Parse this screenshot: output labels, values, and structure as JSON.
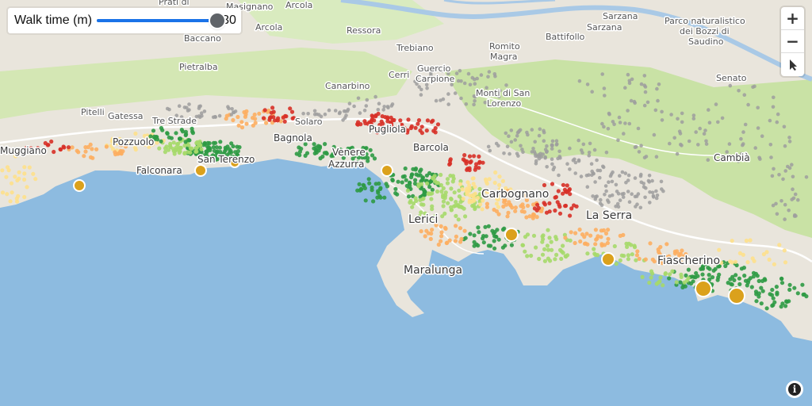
{
  "control": {
    "walk_label": "Walk time (m)",
    "walk_value": "30",
    "walk_min": 0,
    "walk_max": 30,
    "walk_current": 30
  },
  "zoom_controls": {
    "zoom_in": "+",
    "zoom_out": "−",
    "compass": "compass-icon"
  },
  "attribution": {
    "icon": "info-icon"
  },
  "colors": {
    "sea": "#8dbbe0",
    "land": "#e9e5dc",
    "park": "#c9e2a5",
    "green": "#2e9a44",
    "light_green": "#a6d96a",
    "yellow": "#fee08b",
    "orange": "#fdae61",
    "red": "#d73027",
    "grey": "#9e9e9e",
    "stop": "#dba11c"
  },
  "places": {
    "pratidi": "Prati di",
    "masignano": "Masignano",
    "arcola_n": "Arcola",
    "sarzana": "Sarzana",
    "sarzana2": "Sarzana",
    "parco1": "Parco naturalistico",
    "parco2": "dei Bozzi di",
    "parco3": "Saudino",
    "baccano": "Baccano",
    "arcola": "Arcola",
    "ressora": "Ressora",
    "battifollo": "Battifollo",
    "romito1": "Romito",
    "romito2": "Magra",
    "trebiano": "Trebiano",
    "guercio1": "Guercio",
    "guercio2": "Carpione",
    "pietralba": "Pietralba",
    "cerri": "Cerri",
    "canarbino": "Canarbino",
    "senato": "Senato",
    "monti1": "Monti di San",
    "monti2": "Lorenzo",
    "pitelli": "Pitelli",
    "gatessa": "Gatessa",
    "trestrade": "Tre Strade",
    "solaro": "Solaro",
    "pugliola": "Pugliola",
    "muggiano": "Muggiano",
    "pozzuolo": "Pozzuolo",
    "bagnola": "Bagnola",
    "venere": "Venere",
    "azzurra": "Azzurra",
    "barcola": "Barcola",
    "cambia": "Cambià",
    "falconara": "Falconara",
    "santerenzo": "San Terenzo",
    "carbognano": "Carbognano",
    "lerici": "Lerici",
    "laserra": "La Serra",
    "maralunga": "Maralunga",
    "fiascherino": "Fiascherino"
  }
}
